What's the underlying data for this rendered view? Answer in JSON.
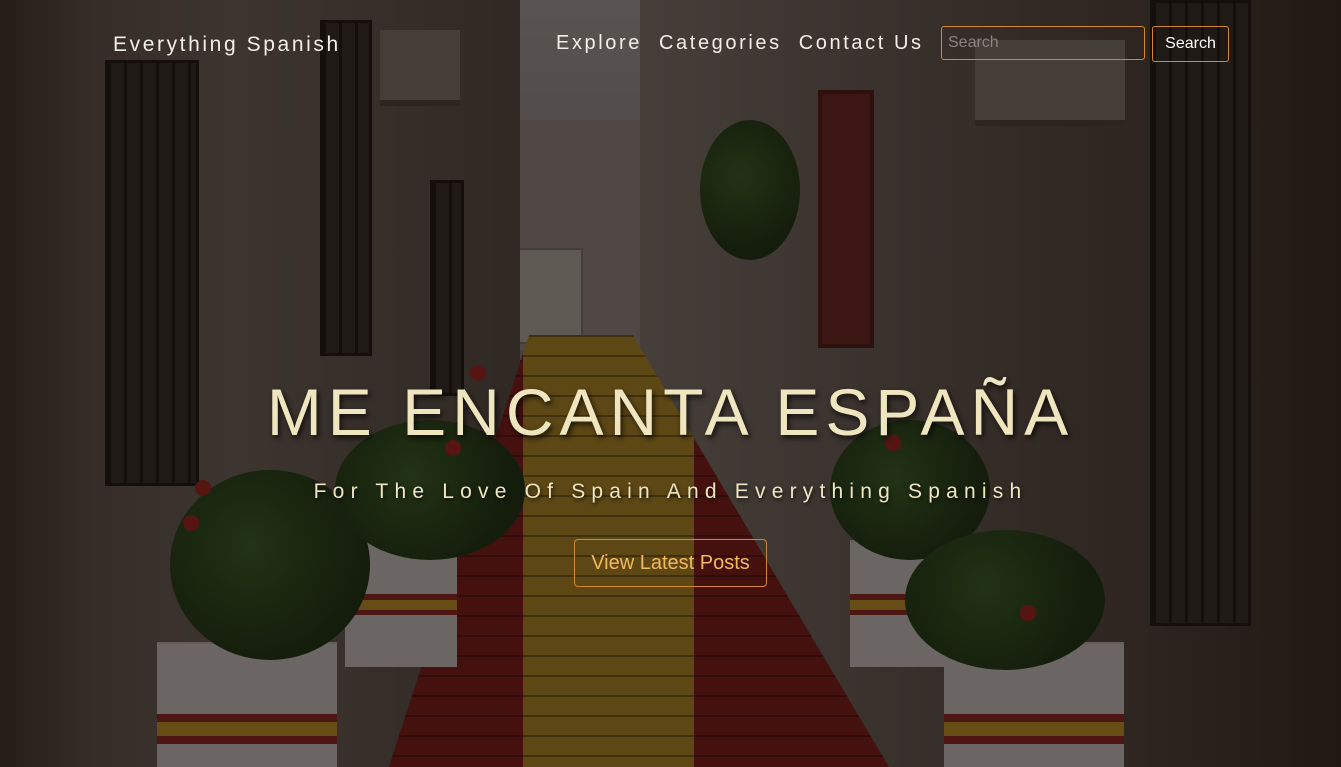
{
  "header": {
    "brand": "Everything Spanish",
    "nav": [
      {
        "label": "Explore"
      },
      {
        "label": "Categories"
      },
      {
        "label": "Contact Us"
      }
    ],
    "search": {
      "placeholder": "Search",
      "value": "",
      "button_label": "Search"
    }
  },
  "hero": {
    "title": "ME ENCANTA ESPAÑA",
    "subtitle": "For The Love Of Spain And Everything Spanish",
    "cta_label": "View Latest Posts"
  },
  "colors": {
    "accent_border": "#d5872b",
    "cta_text": "#f3b85c",
    "hero_text": "#efe6c0"
  }
}
